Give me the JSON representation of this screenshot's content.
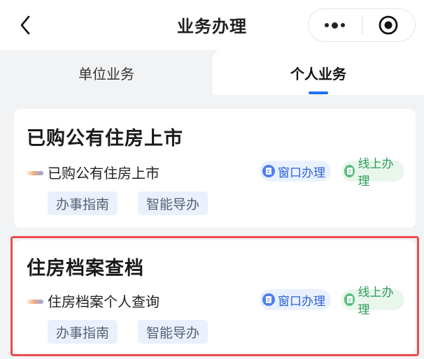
{
  "header": {
    "title": "业务办理",
    "back_icon": "chevron-left-icon",
    "more_icon": "more-dots-icon",
    "close_icon": "target-circle-icon"
  },
  "tabs": [
    {
      "label": "单位业务",
      "active": false
    },
    {
      "label": "个人业务",
      "active": true
    }
  ],
  "accent_color": "#1e6ff5",
  "highlight_color": "#ee4b4b",
  "cards": [
    {
      "title": "已购公有住房上市",
      "item": "已购公有住房上市",
      "badges": [
        "窗口办理",
        "线上办理"
      ],
      "buttons": [
        "办事指南",
        "智能导办"
      ]
    },
    {
      "title": "住房档案查档",
      "item": "住房档案个人查询",
      "badges": [
        "窗口办理",
        "线上办理"
      ],
      "buttons": [
        "办事指南",
        "智能导办"
      ],
      "highlighted": true
    }
  ]
}
